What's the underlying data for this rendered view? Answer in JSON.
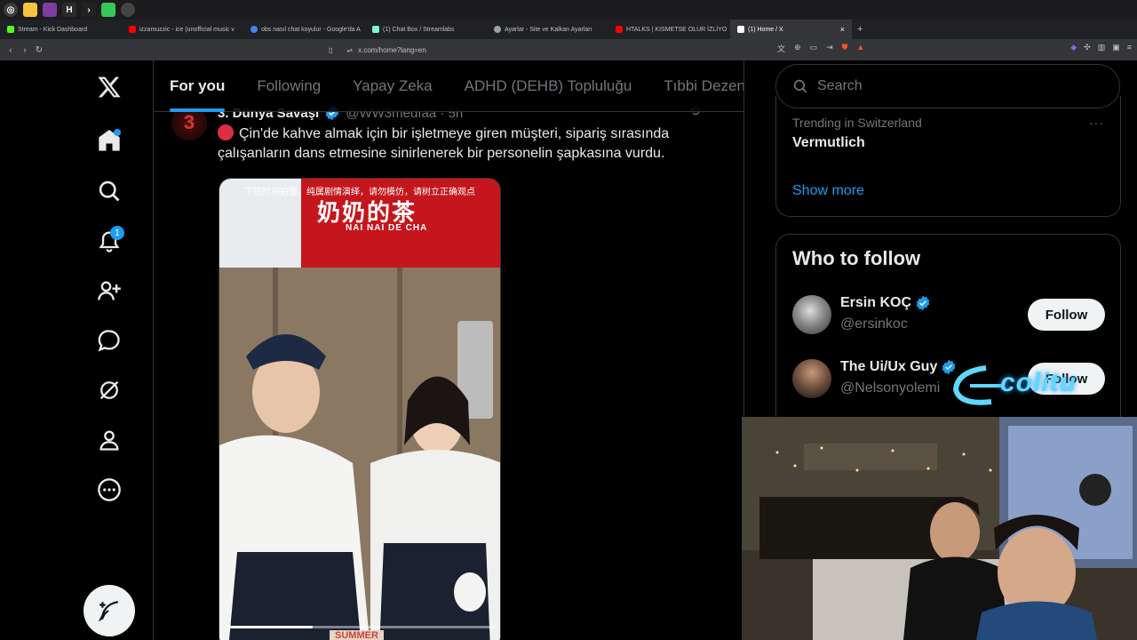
{
  "browser": {
    "tabs": [
      {
        "label": "Stream - Kick Dashboard",
        "color": "#53fc18"
      },
      {
        "label": "izzamuzzic - ice (unofficial music v",
        "color": "#ff0000"
      },
      {
        "label": "obs nasıl chat koyulur - Google'da A",
        "color": "#4285f4"
      },
      {
        "label": "(1) Chat Box / Streamlabs",
        "color": "#80f5d2"
      },
      {
        "label": "Ayarlar - Site ve Kalkan Ayarları",
        "color": "#9aa0a6"
      },
      {
        "label": "HTALKS | KISMETSE OLUR İZLİYO",
        "color": "#ff0000"
      },
      {
        "label": "(1) Home / X",
        "color": "#ffffff"
      }
    ],
    "active_tab_close": "×",
    "new_tab": "+",
    "url": "x.com/home?lang=en"
  },
  "x": {
    "nav": {
      "notifications_badge": "1"
    },
    "topnav": {
      "tabs": [
        "For you",
        "Following",
        "Yapay Zeka",
        "ADHD (DEHB) Topluluğu",
        "Tıbbi Dezenf"
      ]
    },
    "tweet": {
      "avatar_text": "3",
      "name": "3. Dünya Savaşı",
      "handle": "@WW3medıaa · 5h",
      "text": "Çin'de kahve almak için bir işletmeye giren müşteri, sipariş sırasında çalışanların dans etmesine sinirlenerek bir personelin şapkasına vurdu.",
      "media_caption": "下班时间拍摄，纯属剧情演绎，请勿模仿，请树立正确观点",
      "media_sign": "奶奶的茶",
      "media_sign_sub": "NAI NAI DE CHA",
      "media_bottom": "SUMMER"
    },
    "search": {
      "placeholder": "Search"
    },
    "trending": {
      "category": "Trending in Switzerland",
      "name": "Vermutlich",
      "more": "···",
      "show_more": "Show more"
    },
    "who_to_follow": {
      "title": "Who to follow",
      "users": [
        {
          "name": "Ersin KOÇ",
          "handle": "@ersinkoc",
          "button": "Follow"
        },
        {
          "name": "The Ui/Ux Guy",
          "handle": "@Nelsonyolemi",
          "button": "Follow"
        }
      ]
    }
  },
  "overlay": {
    "logo": "colitu"
  },
  "colors": {
    "accent": "#1d9bf0",
    "background": "#000000",
    "border": "#2f3336"
  }
}
